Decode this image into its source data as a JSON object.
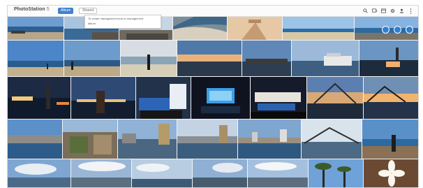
{
  "app": {
    "name": "PhotoStation",
    "version": "5"
  },
  "tabs": [
    {
      "label": "Album"
    },
    {
      "label": "Shared"
    }
  ],
  "tooltip": {
    "line1": "To create management tools in management",
    "line2": "album"
  },
  "toolbar_icons": [
    "search-icon",
    "slideshow-icon",
    "upload-icon",
    "settings-icon",
    "user-icon",
    "more-icon"
  ],
  "accent_color": "#3f82cf"
}
